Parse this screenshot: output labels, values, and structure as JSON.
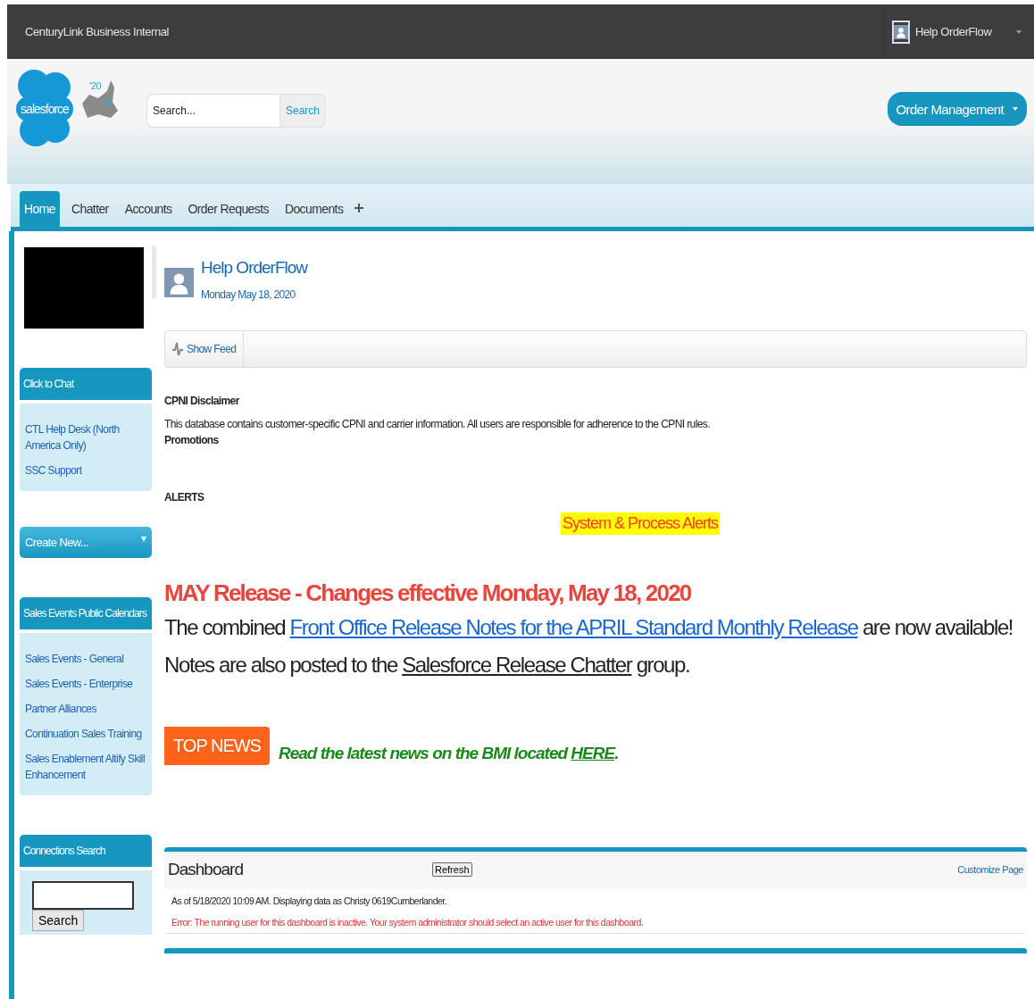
{
  "topbar": {
    "org": "CenturyLink Business Internal",
    "user": "Help OrderFlow"
  },
  "header": {
    "logo": "salesforce",
    "logo_year": "'20",
    "search": {
      "placeholder": "Search...",
      "button": "Search"
    },
    "app_menu": "Order Management"
  },
  "tabs": [
    {
      "label": "Home",
      "selected": true
    },
    {
      "label": "Chatter",
      "selected": false
    },
    {
      "label": "Accounts",
      "selected": false
    },
    {
      "label": "Order Requests",
      "selected": false
    },
    {
      "label": "Documents",
      "selected": false
    }
  ],
  "sidebar": [
    {
      "kind": "links",
      "title": "Click to Chat",
      "links": [
        "CTL Help Desk (North America Only)",
        "SSC Support"
      ]
    },
    {
      "kind": "dropdown",
      "title": "Create New..."
    },
    {
      "kind": "links",
      "title": "Sales Events Public Calendars",
      "links": [
        "Sales Events - General",
        "Sales Events - Enterprise",
        "Partner Alliances",
        "Continuation Sales Training",
        "Sales Enablement Altify Skill Enhancement"
      ]
    },
    {
      "kind": "search",
      "title": "Connections Search",
      "button": "Search"
    }
  ],
  "profile": {
    "name": "Help OrderFlow",
    "date": "Monday May 18, 2020",
    "show_feed": "Show Feed"
  },
  "cpni": {
    "title": "CPNI Disclaimer",
    "text": "This database contains customer-specific CPNI and carrier information. All users are responsible for adherence to the CPNI rules.",
    "promotions": "Promotions"
  },
  "alerts": {
    "title": "ALERTS",
    "banner": "System & Process Alerts"
  },
  "release": {
    "heading": "MAY Release - Changes effective Monday, May 18, 2020",
    "text_before": "The combined ",
    "link": "Front Office Release Notes for the APRIL Standard Monthly Release",
    "text_middle": " are now available!  Notes are also posted to the ",
    "link2": "Salesforce Release Chatter",
    "text_after": " group."
  },
  "top_news": {
    "badge": "TOP NEWS",
    "text": "Read the latest news on the BMI located ",
    "link": "HERE",
    "text_after": "."
  },
  "dashboard": {
    "title": "Dashboard",
    "refresh": "Refresh",
    "customize": "Customize Page",
    "as_of": "As of 5/18/2020 10:09 AM. Displaying data as Christy 0619Cumberlander.",
    "error": "Error: The running user for this dashboard is inactive. Your system administrator should select an active user for this dashboard."
  }
}
